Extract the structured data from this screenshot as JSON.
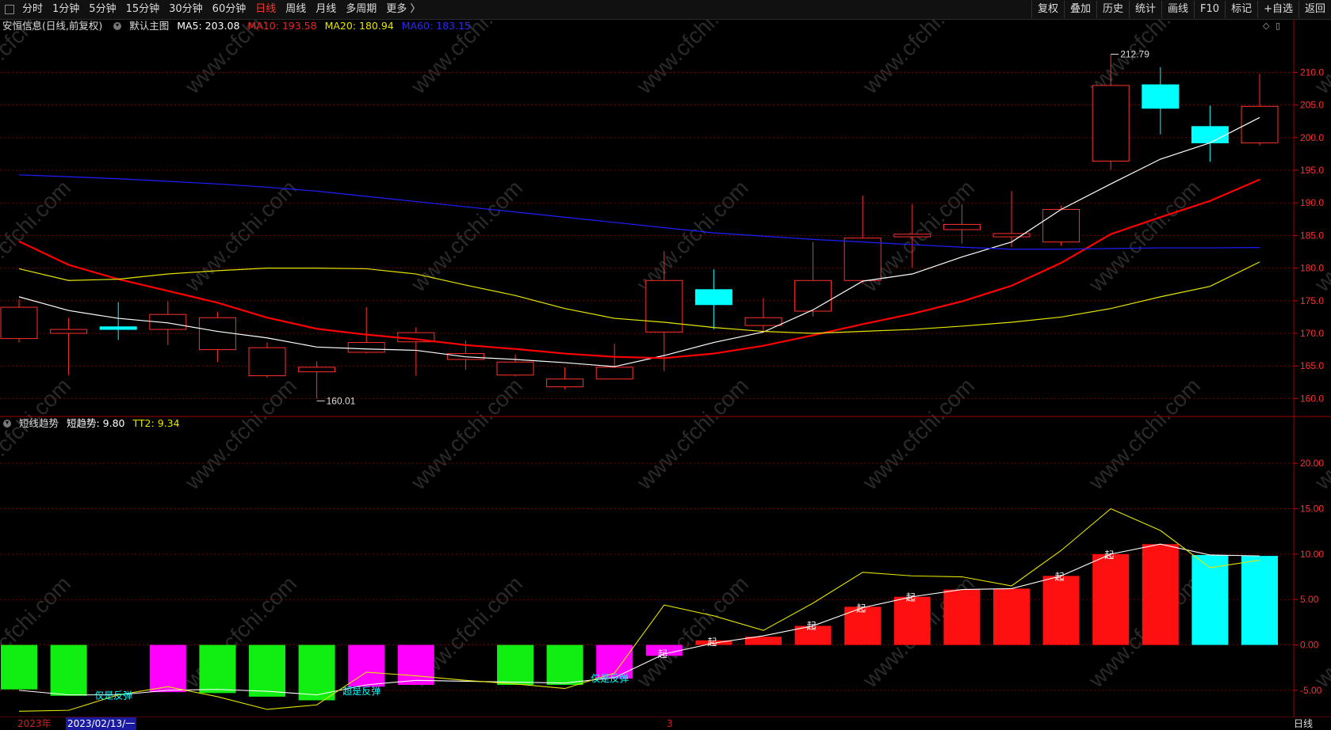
{
  "toolbar": {
    "periods": [
      "分时",
      "1分钟",
      "5分钟",
      "15分钟",
      "30分钟",
      "60分钟",
      "日线",
      "周线",
      "月线",
      "多周期",
      "更多 〉"
    ],
    "active_index": 6,
    "right_buttons": [
      "复权",
      "叠加",
      "历史",
      "统计",
      "画线",
      "F10",
      "标记",
      "+自选",
      "返回"
    ]
  },
  "main_legend": {
    "title": "安恒信息(日线,前复权)",
    "indicator": "默认主图",
    "ma5": "MA5: 203.08",
    "ma10": "MA10: 193.58",
    "ma20": "MA20: 180.94",
    "ma60": "MA60: 183.15"
  },
  "sub_legend": {
    "name": "短线趋势",
    "v1": "短趋势: 9.80",
    "v2": "TT2: 9.34"
  },
  "status": {
    "year": "2023年",
    "date": "2023/02/13/一",
    "month": "3",
    "period": "日线"
  },
  "colors": {
    "up": "#ff3030",
    "down": "#00ffff",
    "ma5": "#ffffff",
    "ma10": "#ff0000",
    "ma20": "#e5e500",
    "ma60": "#1e1eff",
    "grid": "#7a0000",
    "axis_text": "#ff3030"
  },
  "chart_data": [
    {
      "type": "candlestick",
      "title": "安恒信息(日线,前复权)",
      "ylim": [
        157.5,
        216
      ],
      "yticks": [
        160,
        165,
        170,
        175,
        180,
        185,
        190,
        195,
        200,
        205,
        210
      ],
      "candles": [
        {
          "o": 169.2,
          "h": 175.2,
          "l": 168.6,
          "c": 174.0
        },
        {
          "o": 170.0,
          "h": 172.4,
          "l": 163.6,
          "c": 170.6
        },
        {
          "o": 171.0,
          "h": 174.8,
          "l": 169.0,
          "c": 170.6
        },
        {
          "o": 170.6,
          "h": 174.9,
          "l": 168.2,
          "c": 172.9
        },
        {
          "o": 167.5,
          "h": 173.3,
          "l": 165.6,
          "c": 172.4
        },
        {
          "o": 163.5,
          "h": 168.6,
          "l": 163.2,
          "c": 167.8
        },
        {
          "o": 164.1,
          "h": 165.7,
          "l": 160.0,
          "c": 164.8
        },
        {
          "o": 167.1,
          "h": 174.0,
          "l": 166.9,
          "c": 168.6
        },
        {
          "o": 168.7,
          "h": 170.9,
          "l": 163.5,
          "c": 170.1
        },
        {
          "o": 166.0,
          "h": 168.9,
          "l": 164.4,
          "c": 166.9
        },
        {
          "o": 163.6,
          "h": 166.8,
          "l": 163.4,
          "c": 165.6
        },
        {
          "o": 161.8,
          "h": 164.8,
          "l": 161.4,
          "c": 163.0
        },
        {
          "o": 163.0,
          "h": 168.4,
          "l": 163.0,
          "c": 164.8
        },
        {
          "o": 170.2,
          "h": 182.6,
          "l": 164.2,
          "c": 178.1
        },
        {
          "o": 176.7,
          "h": 179.8,
          "l": 170.6,
          "c": 174.4
        },
        {
          "o": 171.2,
          "h": 175.4,
          "l": 170.3,
          "c": 172.4
        },
        {
          "o": 173.4,
          "h": 184.0,
          "l": 172.6,
          "c": 178.1
        },
        {
          "o": 178.1,
          "h": 191.1,
          "l": 177.6,
          "c": 184.6
        },
        {
          "o": 184.8,
          "h": 189.8,
          "l": 180.1,
          "c": 185.2
        },
        {
          "o": 185.9,
          "h": 189.8,
          "l": 183.8,
          "c": 186.7
        },
        {
          "o": 184.8,
          "h": 191.8,
          "l": 183.2,
          "c": 185.3
        },
        {
          "o": 184.0,
          "h": 189.6,
          "l": 183.4,
          "c": 189.0
        },
        {
          "o": 196.4,
          "h": 212.79,
          "l": 195.1,
          "c": 208.0
        },
        {
          "o": 208.1,
          "h": 210.8,
          "l": 200.5,
          "c": 204.5
        },
        {
          "o": 201.7,
          "h": 204.9,
          "l": 196.3,
          "c": 199.2
        },
        {
          "o": 199.2,
          "h": 209.8,
          "l": 198.8,
          "c": 204.8
        }
      ],
      "series": [
        {
          "name": "MA5",
          "values": [
            175.6,
            173.5,
            172.3,
            171.6,
            170.3,
            169.3,
            167.9,
            167.6,
            167.4,
            166.4,
            166.0,
            165.5,
            164.9,
            166.6,
            168.6,
            170.2,
            173.6,
            178.0,
            179.1,
            181.7,
            184.0,
            189.0,
            192.9,
            196.7,
            199.2,
            203.08
          ]
        },
        {
          "name": "MA10",
          "values": [
            184.1,
            180.5,
            178.3,
            176.5,
            174.7,
            172.4,
            170.7,
            169.8,
            169.1,
            168.2,
            167.6,
            166.9,
            166.4,
            166.2,
            166.9,
            168.1,
            169.7,
            171.4,
            173.0,
            174.9,
            177.3,
            180.8,
            185.2,
            187.8,
            190.3,
            193.58
          ]
        },
        {
          "name": "MA20",
          "values": [
            179.9,
            178.1,
            178.3,
            179.1,
            179.6,
            180.0,
            180.0,
            179.9,
            179.1,
            177.4,
            175.8,
            173.8,
            172.3,
            171.7,
            170.9,
            170.3,
            170.0,
            170.3,
            170.6,
            171.1,
            171.7,
            172.5,
            173.8,
            175.6,
            177.2,
            180.94
          ]
        },
        {
          "name": "MA60",
          "values": [
            194.3,
            194.0,
            193.7,
            193.3,
            192.9,
            192.4,
            191.8,
            191.0,
            190.2,
            189.4,
            188.6,
            187.8,
            187.0,
            186.2,
            185.4,
            184.9,
            184.4,
            184.0,
            183.6,
            183.2,
            182.9,
            182.9,
            183.0,
            183.1,
            183.1,
            183.15
          ]
        }
      ],
      "annotations": [
        {
          "index": 6,
          "value": 160.01,
          "text": "160.01"
        },
        {
          "index": 22,
          "value": 212.79,
          "text": "212.79"
        }
      ]
    },
    {
      "type": "bar",
      "title": "短线趋势",
      "ylim": [
        -7.8,
        23.5
      ],
      "yticks": [
        -5,
        0,
        5,
        10,
        15,
        20
      ],
      "bars": [
        -4.9,
        -5.6,
        0,
        -5.2,
        -5.3,
        -5.7,
        -6.1,
        -4.6,
        -4.4,
        0,
        -4.4,
        -4.4,
        -3.7,
        -1.2,
        0.5,
        0.9,
        2.1,
        4.2,
        5.3,
        6.1,
        6.2,
        7.6,
        10.0,
        11.1,
        9.9,
        9.8
      ],
      "bar_colors": [
        "green",
        "green",
        "none",
        "magenta",
        "green",
        "green",
        "green",
        "magenta",
        "magenta",
        "none",
        "green",
        "green",
        "magenta",
        "magenta",
        "red",
        "red",
        "red",
        "red",
        "red",
        "red",
        "red",
        "red",
        "red",
        "red",
        "cyan",
        "cyan"
      ],
      "series": [
        {
          "name": "短趋势",
          "values": [
            -5.0,
            -5.5,
            -5.5,
            -5.0,
            -4.9,
            -5.1,
            -5.5,
            -4.4,
            -3.9,
            -4.0,
            -4.1,
            -4.2,
            -3.6,
            -1.0,
            0.2,
            1.0,
            2.1,
            4.1,
            5.3,
            6.1,
            6.2,
            7.6,
            10.0,
            11.1,
            9.9,
            9.8
          ]
        },
        {
          "name": "TT2",
          "values": [
            -7.3,
            -7.2,
            -5.5,
            -4.6,
            -5.7,
            -7.1,
            -6.6,
            -3.0,
            -3.4,
            -3.9,
            -4.3,
            -4.8,
            -3.1,
            4.4,
            3.2,
            1.6,
            4.6,
            8.0,
            7.6,
            7.5,
            6.5,
            10.4,
            15.0,
            12.6,
            8.5,
            9.34
          ]
        }
      ],
      "labels": [
        {
          "index": 2,
          "value": -5.5,
          "text": "仅是反弹",
          "color": "cyan"
        },
        {
          "index": 7,
          "value": -5.0,
          "text": "超是反弹",
          "color": "cyan"
        },
        {
          "index": 12,
          "value": -3.6,
          "text": "仅是反弹",
          "color": "cyan"
        },
        {
          "index": 13,
          "value": -0.9,
          "text": "起",
          "color": "white"
        },
        {
          "index": 14,
          "value": 0.4,
          "text": "起",
          "color": "white"
        },
        {
          "index": 16,
          "value": 2.2,
          "text": "起",
          "color": "white"
        },
        {
          "index": 17,
          "value": 4.1,
          "text": "起",
          "color": "white"
        },
        {
          "index": 18,
          "value": 5.3,
          "text": "起",
          "color": "white"
        },
        {
          "index": 21,
          "value": 7.6,
          "text": "起",
          "color": "white"
        },
        {
          "index": 22,
          "value": 10.0,
          "text": "起",
          "color": "white"
        }
      ]
    }
  ]
}
